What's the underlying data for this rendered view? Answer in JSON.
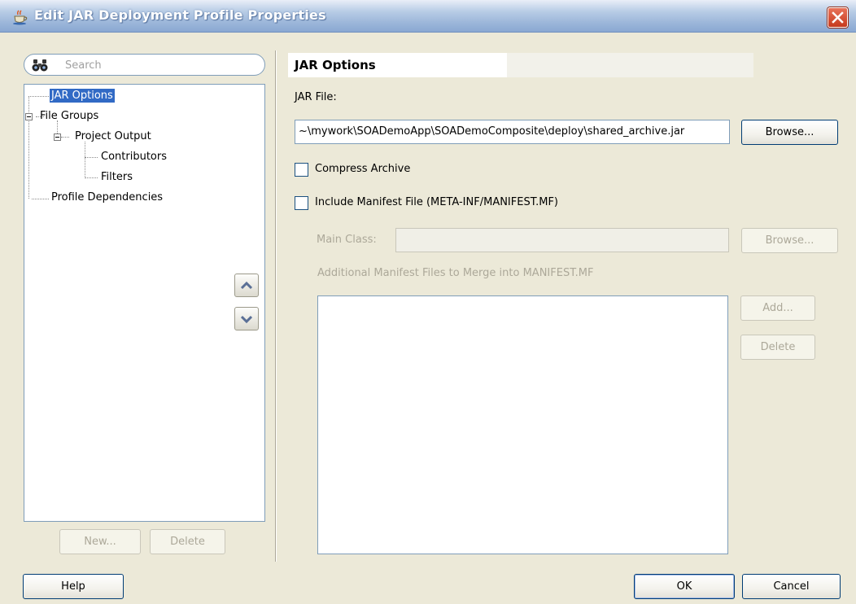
{
  "window": {
    "title": "Edit JAR Deployment Profile Properties",
    "icon": "java-cup-icon",
    "close_label": "✕"
  },
  "search": {
    "placeholder": "Search"
  },
  "tree": {
    "items": [
      {
        "label": "JAR Options",
        "selected": true
      },
      {
        "label": "File Groups"
      },
      {
        "label": "Project Output"
      },
      {
        "label": "Contributors"
      },
      {
        "label": "Filters"
      },
      {
        "label": "Profile Dependencies"
      }
    ]
  },
  "left_buttons": {
    "new": "New...",
    "delete": "Delete"
  },
  "section": {
    "title": "JAR Options"
  },
  "jar_file": {
    "label": "JAR File:",
    "value": "~\\mywork\\SOADemoApp\\SOADemoComposite\\deploy\\shared_archive.jar",
    "browse": "Browse..."
  },
  "compress": {
    "label": "Compress Archive",
    "checked": false
  },
  "manifest": {
    "label": "Include Manifest File (META-INF/MANIFEST.MF)",
    "checked": false
  },
  "main_class": {
    "label": "Main Class:",
    "value": "",
    "browse": "Browse..."
  },
  "additional": {
    "label": "Additional Manifest Files to Merge into MANIFEST.MF",
    "add": "Add...",
    "delete": "Delete"
  },
  "footer": {
    "help": "Help",
    "ok": "OK",
    "cancel": "Cancel"
  },
  "colors": {
    "selection": "#316ac5",
    "dialog_bg": "#ece9d8",
    "border": "#7f9db9"
  }
}
